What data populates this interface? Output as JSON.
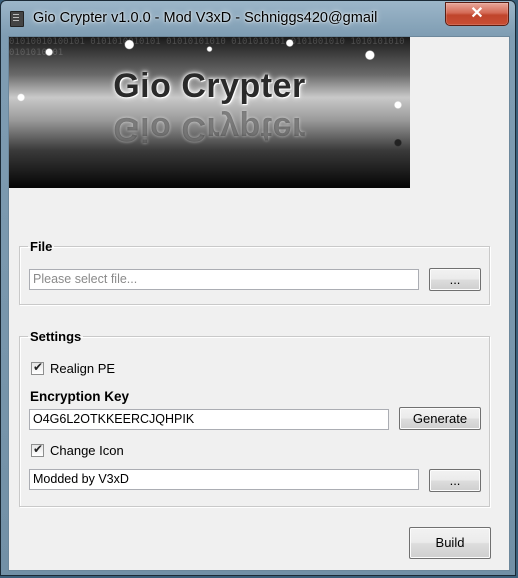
{
  "window": {
    "title": "Gio Crypter v1.0.0 - Mod V3xD  - Schniggs420@gmail",
    "close_label": "✕"
  },
  "banner": {
    "title": "Gio Crypter"
  },
  "file_group": {
    "legend": "File",
    "input_placeholder": "Please select file...",
    "input_value": "",
    "browse_label": "..."
  },
  "settings_group": {
    "legend": "Settings",
    "realign_label": "Realign PE",
    "realign_checked": true,
    "key_label": "Encryption Key",
    "key_value": "O4G6L2OTKKEERCJQHPIK",
    "generate_label": "Generate",
    "change_icon_label": "Change Icon",
    "change_icon_checked": true,
    "icon_value": "Modded by V3xD",
    "icon_browse_label": "..."
  },
  "build_label": "Build",
  "colors": {
    "title_bar": "#7f9db3",
    "close_button": "#c94e34",
    "client_bg": "#f0f0f0"
  }
}
